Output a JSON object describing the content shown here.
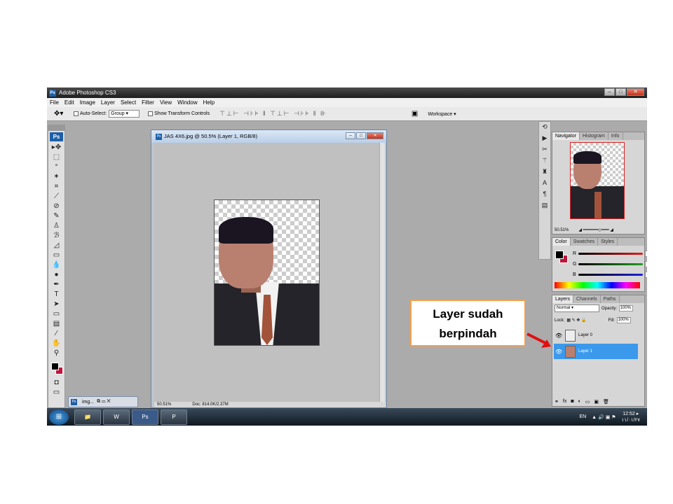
{
  "app": {
    "title": "Adobe Photoshop CS3",
    "logo_text": "Ps"
  },
  "menu": [
    "File",
    "Edit",
    "Image",
    "Layer",
    "Select",
    "Filter",
    "View",
    "Window",
    "Help"
  ],
  "options_bar": {
    "auto_select_label": "Auto-Select:",
    "auto_select_value": "Group",
    "show_transform_label": "Show Transform Controls",
    "workspace_label": "Workspace ▾"
  },
  "document": {
    "title": "JAS 4X6.jpg @ 50.5% (Layer 1, RGB/8)",
    "zoom": "50.5%",
    "status": "Doc: 814.0K/2.37M",
    "zoom_status": "50.51%"
  },
  "navigator": {
    "tabs": [
      "Navigator",
      "Histogram",
      "Info"
    ],
    "zoom": "50.51%"
  },
  "color_panel": {
    "tabs": [
      "Color",
      "Swatches",
      "Styles"
    ],
    "channels": [
      {
        "label": "R",
        "value": "0",
        "color": "#e02020"
      },
      {
        "label": "G",
        "value": "0",
        "color": "#20a020"
      },
      {
        "label": "B",
        "value": "0",
        "color": "#2020e0"
      }
    ]
  },
  "layers_panel": {
    "tabs": [
      "Layers",
      "Channels",
      "Paths"
    ],
    "blend_mode": "Normal",
    "opacity_label": "Opacity:",
    "opacity": "100%",
    "lock_label": "Lock:",
    "fill_label": "Fill:",
    "fill": "100%",
    "layers": [
      {
        "name": "Layer 0",
        "selected": false
      },
      {
        "name": "Layer 1",
        "selected": true
      }
    ]
  },
  "minimized_doc": {
    "label": "img..."
  },
  "callout": {
    "line1": "Layer sudah",
    "line2": "berpindah"
  },
  "taskbar": {
    "buttons": [
      "Explorer",
      "Word",
      "Ps",
      "PowerPoint"
    ],
    "language": "EN",
    "time": "12:52 ▸",
    "date": "١١/٠١/٢٧"
  },
  "colors": {
    "accent": "#3b99ec",
    "callout_border": "#f0a050",
    "arrow": "#e01010",
    "background_swatch": "#c0143c"
  }
}
